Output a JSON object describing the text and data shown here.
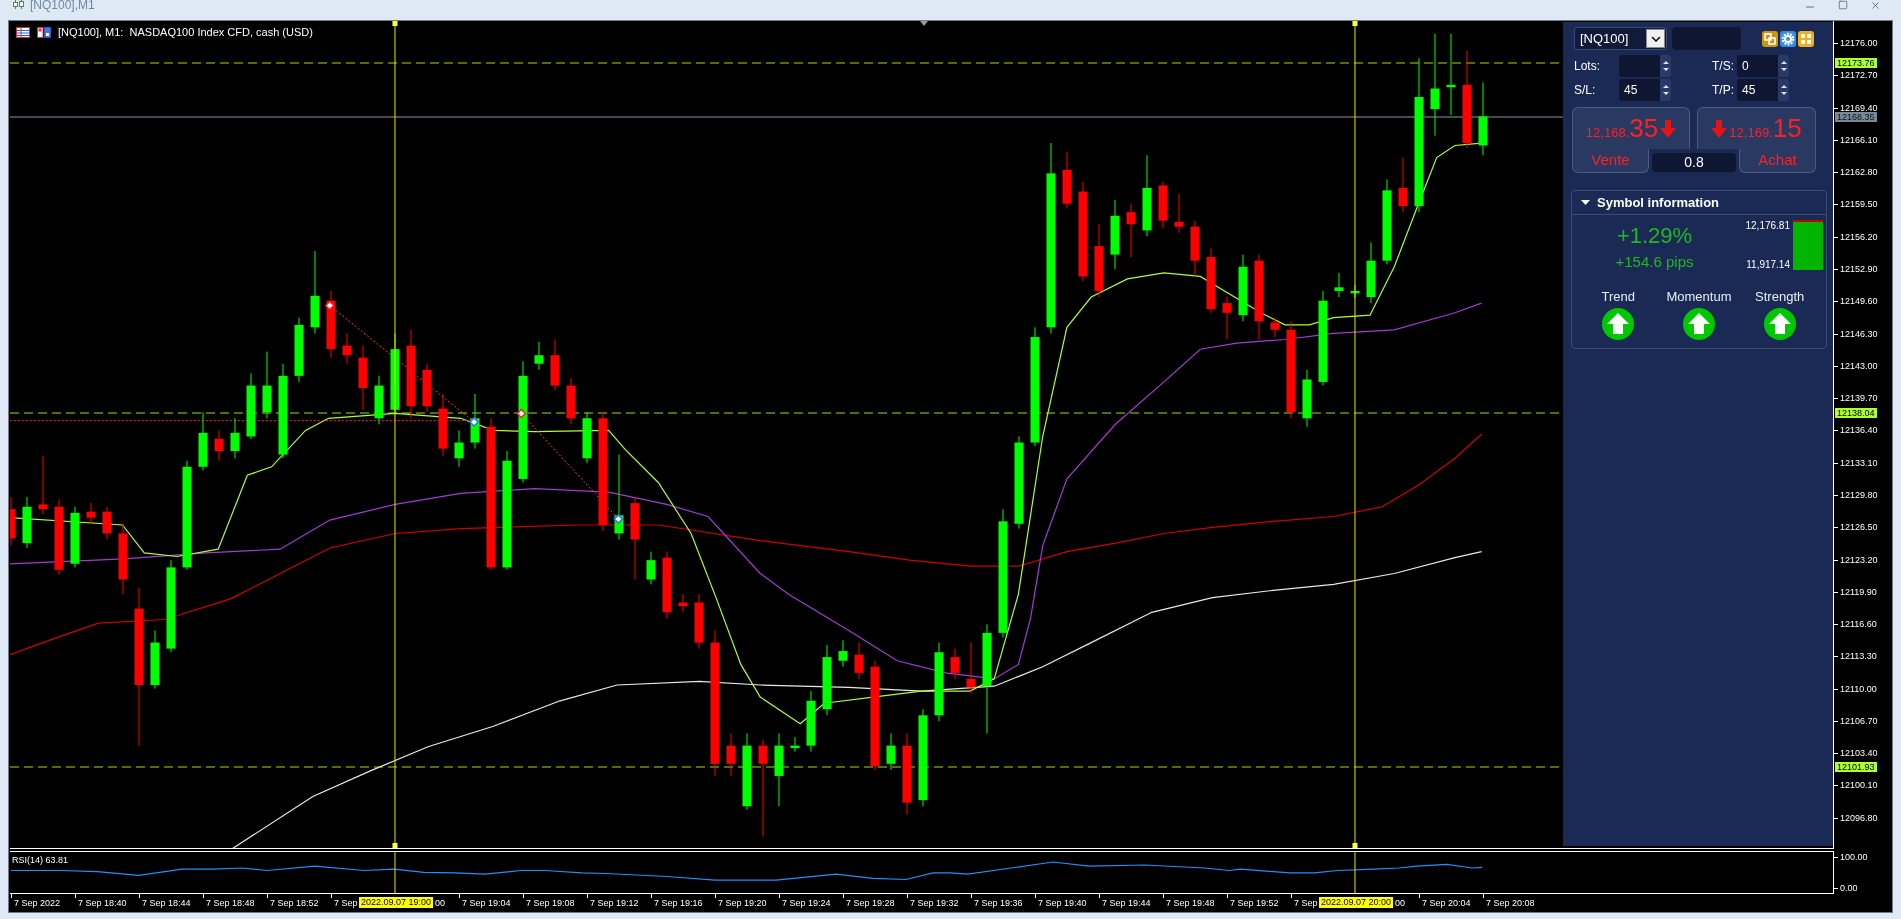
{
  "window": {
    "title": "[NQ100],M1"
  },
  "chart": {
    "header": "[NQ100], M1:  NASDAQ100 Index CFD, cash (USD)"
  },
  "price_axis": {
    "ticks": [
      "12176.00",
      "12172.70",
      "12169.40",
      "12166.10",
      "12162.80",
      "12159.50",
      "12156.20",
      "12152.90",
      "12149.60",
      "12146.30",
      "12143.00",
      "12139.70",
      "12136.40",
      "12133.10",
      "12129.80",
      "12126.50",
      "12123.20",
      "12119.90",
      "12116.60",
      "12113.30",
      "12110.00",
      "12106.70",
      "12103.40",
      "12100.10",
      "12096.80"
    ],
    "markers": [
      {
        "label": "12173.76",
        "kind": "level"
      },
      {
        "label": "12168.35",
        "kind": "bid"
      },
      {
        "label": "12138.04",
        "kind": "level"
      },
      {
        "label": "12101.93",
        "kind": "level"
      }
    ]
  },
  "rsi": {
    "label": "RSI(14) 63.81",
    "ticks": [
      "100.00",
      "0.00"
    ]
  },
  "time_axis": {
    "labels": [
      {
        "text": "7 Sep 2022",
        "kind": "full"
      },
      {
        "text": "7 Sep 18:40",
        "kind": "full"
      },
      {
        "text": "7 Sep 18:44",
        "kind": "full"
      },
      {
        "text": "7 Sep 18:48",
        "kind": "full"
      },
      {
        "text": "7 Sep 18:52",
        "kind": "full"
      },
      {
        "text": "7 Sep",
        "kind": "full"
      },
      {
        "text": "00",
        "kind": "tail"
      },
      {
        "text": "7 Sep 19:04",
        "kind": "full"
      },
      {
        "text": "7 Sep 19:08",
        "kind": "full"
      },
      {
        "text": "7 Sep 19:12",
        "kind": "full"
      },
      {
        "text": "7 Sep 19:16",
        "kind": "full"
      },
      {
        "text": "7 Sep 19:20",
        "kind": "full"
      },
      {
        "text": "7 Sep 19:24",
        "kind": "full"
      },
      {
        "text": "7 Sep 19:28",
        "kind": "full"
      },
      {
        "text": "7 Sep 19:32",
        "kind": "full"
      },
      {
        "text": "7 Sep 19:36",
        "kind": "full"
      },
      {
        "text": "7 Sep 19:40",
        "kind": "full"
      },
      {
        "text": "7 Sep 19:44",
        "kind": "full"
      },
      {
        "text": "7 Sep 19:48",
        "kind": "full"
      },
      {
        "text": "7 Sep 19:52",
        "kind": "full"
      },
      {
        "text": "7 Sep",
        "kind": "full"
      },
      {
        "text": "00",
        "kind": "tail"
      },
      {
        "text": "7 Sep 20:04",
        "kind": "full"
      },
      {
        "text": "7 Sep 20:08",
        "kind": "full"
      }
    ],
    "cursor_labels": [
      "2022.09.07 19:00",
      "2022.09.07 20:00"
    ]
  },
  "trade_panel": {
    "symbol": "[NQ100]",
    "fields": [
      {
        "label": "Lots:"
      },
      {
        "label": "T/S:",
        "value": "0"
      },
      {
        "label": "S/L:",
        "value": "45"
      },
      {
        "label": "T/P:",
        "value": "45"
      }
    ],
    "sell": {
      "price": "12,168.",
      "pips": "35",
      "label": "Vente"
    },
    "buy": {
      "price": "12,169.",
      "pips": "15",
      "label": "Achat"
    },
    "volume": "0.8"
  },
  "symbol_info": {
    "title": "Symbol information",
    "expanded": true,
    "change": "+1.29%",
    "pips": "+154.6 pips",
    "high": "12,176.81",
    "low": "11,917.14",
    "level": 0.97,
    "signals": [
      {
        "label": "Trend",
        "rising": true
      },
      {
        "label": "Momentum",
        "rising": true
      },
      {
        "label": "Strength",
        "rising": true
      }
    ]
  }
}
